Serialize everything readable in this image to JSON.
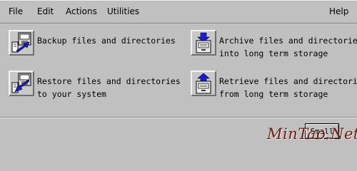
{
  "menubar": {
    "items": [
      {
        "label": "File"
      },
      {
        "label": "Edit"
      },
      {
        "label": "Actions"
      },
      {
        "label": "Utilities"
      }
    ],
    "help_label": "Help"
  },
  "actions": [
    {
      "icon": "backup-disk-icon",
      "lines": [
        "Backup files and directories"
      ]
    },
    {
      "icon": "archive-cabinet-icon",
      "lines": [
        "Archive files and directories",
        "into long term storage"
      ]
    },
    {
      "icon": "restore-disk-icon",
      "lines": [
        "Restore files and directories",
        "to your system"
      ]
    },
    {
      "icon": "retrieve-cabinet-icon",
      "lines": [
        "Retrieve files and directories",
        "from long term storage"
      ]
    }
  ],
  "footer": {
    "small_label": "Small"
  },
  "watermark": "MinTao.Net",
  "colors": {
    "background": "#c0c0c0",
    "arrow_blue": "#1a1adc",
    "watermark": "#6a1f14"
  }
}
